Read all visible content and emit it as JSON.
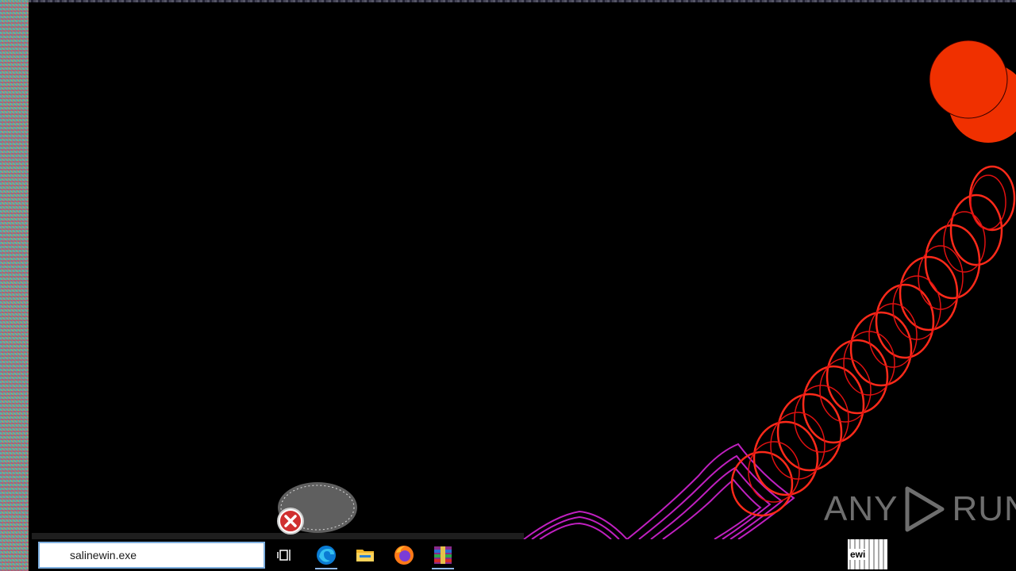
{
  "desktop": {
    "background_color": "#000000",
    "glitch_colors": [
      "#ff2a1a",
      "#f03000",
      "#c020c0"
    ]
  },
  "error_icon": {
    "icon": "error-x-icon",
    "color": "#d03030"
  },
  "taskbar": {
    "search": {
      "value": "salinewin.exe",
      "icon": "search-icon"
    },
    "buttons": [
      {
        "name": "task-view",
        "icon": "task-view-icon"
      },
      {
        "name": "edge",
        "icon": "edge-icon"
      },
      {
        "name": "file-explorer",
        "icon": "folder-icon"
      },
      {
        "name": "firefox",
        "icon": "firefox-icon"
      },
      {
        "name": "winrar",
        "icon": "winrar-icon",
        "active": true
      }
    ],
    "tray_fragment_text": "ewi"
  },
  "watermark": {
    "left": "ANY",
    "right": "RUN"
  }
}
